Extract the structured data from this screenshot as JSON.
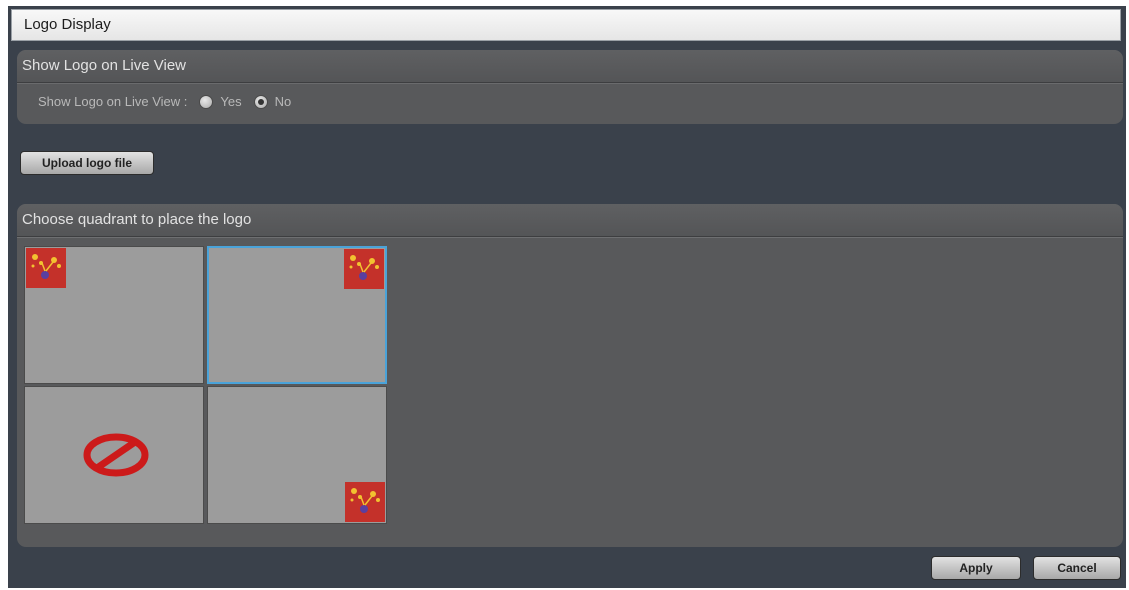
{
  "window": {
    "title": "Logo Display"
  },
  "live_view_panel": {
    "header": "Show Logo on Live View",
    "field_label": "Show Logo on Live View :",
    "options": [
      {
        "label": "Yes",
        "selected": false
      },
      {
        "label": "No",
        "selected": true
      }
    ]
  },
  "upload": {
    "button_label": "Upload logo file"
  },
  "quadrant_panel": {
    "header": "Choose quadrant to place the logo",
    "quadrants": [
      {
        "position": "top-left",
        "state": "logo"
      },
      {
        "position": "top-right",
        "state": "logo",
        "selected": true
      },
      {
        "position": "bottom-left",
        "state": "disabled"
      },
      {
        "position": "bottom-right",
        "state": "logo"
      }
    ],
    "selected_border_color": "#4aa3d9",
    "logo_color": "#c4312a",
    "disabled_icon_color": "#cc1a1a"
  },
  "footer": {
    "apply_label": "Apply",
    "cancel_label": "Cancel"
  }
}
